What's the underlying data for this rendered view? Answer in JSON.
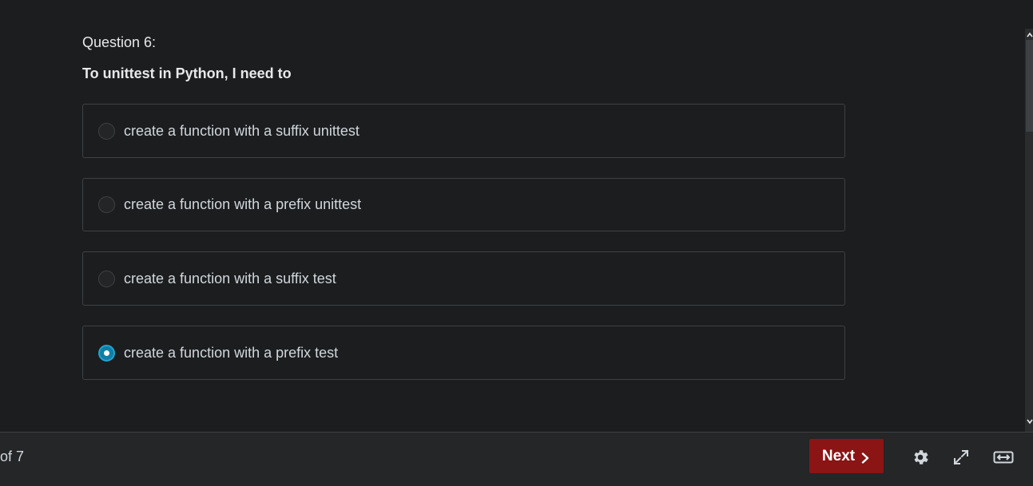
{
  "question": {
    "number_label": "Question 6:",
    "text": "To unittest in Python, I need to"
  },
  "answers": [
    {
      "label": "create a function with a suffix unittest",
      "selected": false
    },
    {
      "label": "create a function with a prefix unittest",
      "selected": false
    },
    {
      "label": "create a function with a suffix test",
      "selected": false
    },
    {
      "label": "create a function with a prefix test",
      "selected": true
    }
  ],
  "footer": {
    "progress_text": "of 7",
    "next_label": "Next",
    "icons": [
      "settings-icon",
      "fullscreen-icon",
      "expand-width-icon"
    ]
  },
  "colors": {
    "background": "#1c1d1f",
    "next_button": "#8b1414",
    "radio_selected": "#0e7fa6"
  }
}
